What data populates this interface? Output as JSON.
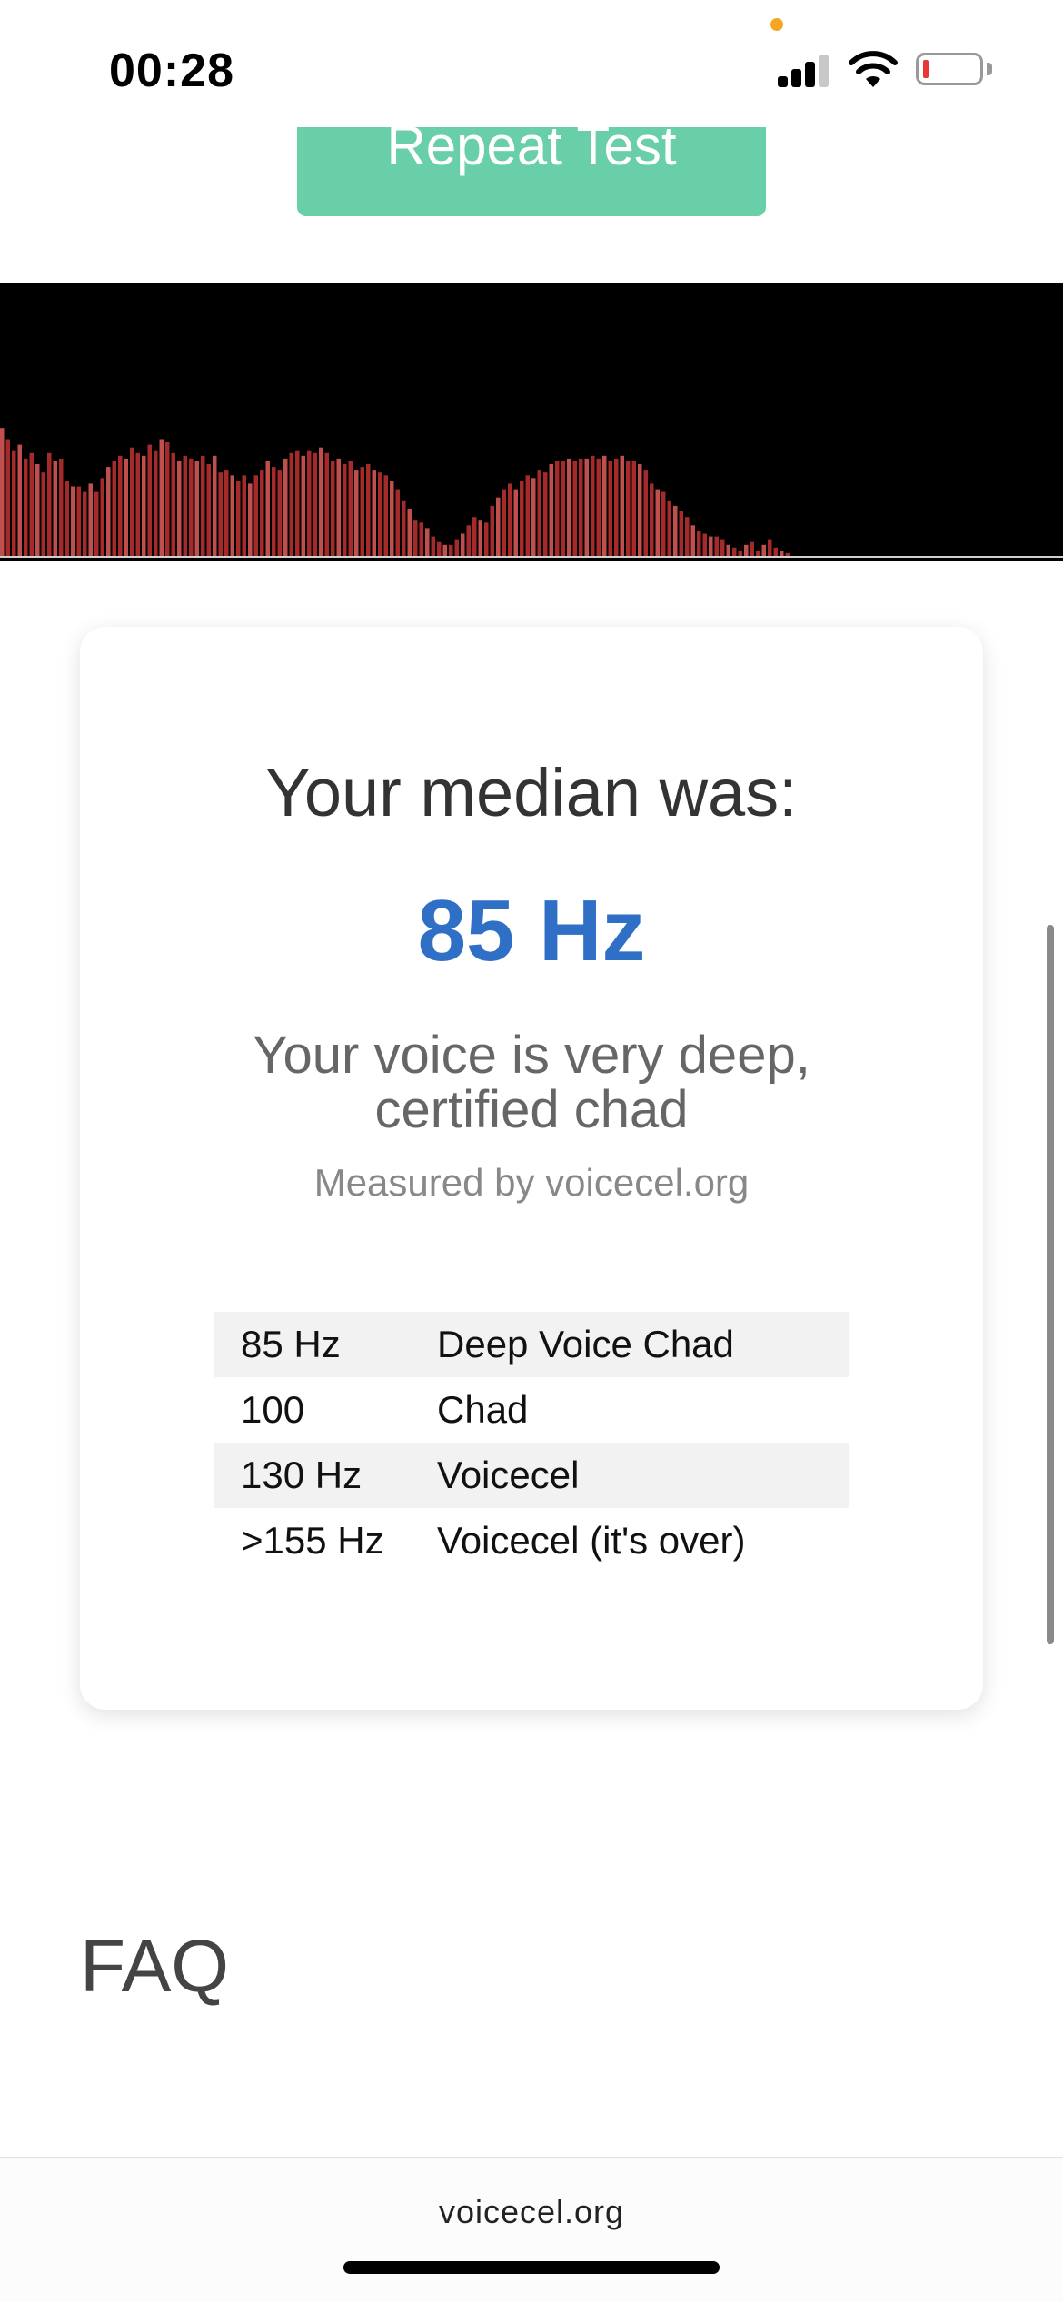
{
  "status_bar": {
    "time": "00:28",
    "recording_dot_color": "#f5a623",
    "battery_level_color": "#e53935",
    "icons": [
      "cellular-signal-icon",
      "wifi-icon",
      "battery-low-icon"
    ]
  },
  "repeat_button": {
    "label": "Repeat Test",
    "color": "#68cfa8"
  },
  "visualizer": {
    "bar_color": "#a52a2a",
    "bar_highlight": "#c0504d",
    "levels": [
      0.46,
      0.42,
      0.38,
      0.4,
      0.35,
      0.37,
      0.33,
      0.3,
      0.37,
      0.34,
      0.35,
      0.27,
      0.25,
      0.25,
      0.23,
      0.26,
      0.23,
      0.28,
      0.32,
      0.34,
      0.36,
      0.35,
      0.39,
      0.37,
      0.36,
      0.4,
      0.38,
      0.42,
      0.41,
      0.37,
      0.34,
      0.36,
      0.35,
      0.34,
      0.36,
      0.33,
      0.36,
      0.3,
      0.31,
      0.29,
      0.27,
      0.29,
      0.26,
      0.29,
      0.31,
      0.34,
      0.32,
      0.31,
      0.35,
      0.37,
      0.38,
      0.36,
      0.38,
      0.37,
      0.39,
      0.37,
      0.34,
      0.35,
      0.33,
      0.34,
      0.31,
      0.32,
      0.33,
      0.31,
      0.3,
      0.29,
      0.27,
      0.24,
      0.2,
      0.17,
      0.13,
      0.12,
      0.1,
      0.07,
      0.05,
      0.04,
      0.04,
      0.06,
      0.08,
      0.11,
      0.14,
      0.13,
      0.12,
      0.18,
      0.21,
      0.24,
      0.26,
      0.24,
      0.27,
      0.29,
      0.28,
      0.31,
      0.3,
      0.33,
      0.34,
      0.34,
      0.35,
      0.34,
      0.35,
      0.35,
      0.36,
      0.35,
      0.36,
      0.34,
      0.35,
      0.36,
      0.34,
      0.34,
      0.33,
      0.31,
      0.26,
      0.24,
      0.23,
      0.2,
      0.18,
      0.16,
      0.14,
      0.11,
      0.09,
      0.08,
      0.07,
      0.07,
      0.06,
      0.04,
      0.03,
      0.02,
      0.04,
      0.05,
      0.02,
      0.04,
      0.06,
      0.03,
      0.02,
      0.01
    ]
  },
  "result": {
    "median_label": "Your median was:",
    "median_value": "85 Hz",
    "median_value_color": "#2f6fc6",
    "verdict": "Your voice is very deep, certified chad",
    "measured_by": "Measured by voicecel.org",
    "ranges": [
      {
        "frequency": "85 Hz",
        "label": "Deep Voice Chad"
      },
      {
        "frequency": "100",
        "label": "Chad"
      },
      {
        "frequency": "130 Hz",
        "label": "Voicecel"
      },
      {
        "frequency": ">155 Hz",
        "label": "Voicecel (it's over)"
      }
    ]
  },
  "faq": {
    "heading": "FAQ"
  },
  "browser": {
    "url": "voicecel.org"
  }
}
